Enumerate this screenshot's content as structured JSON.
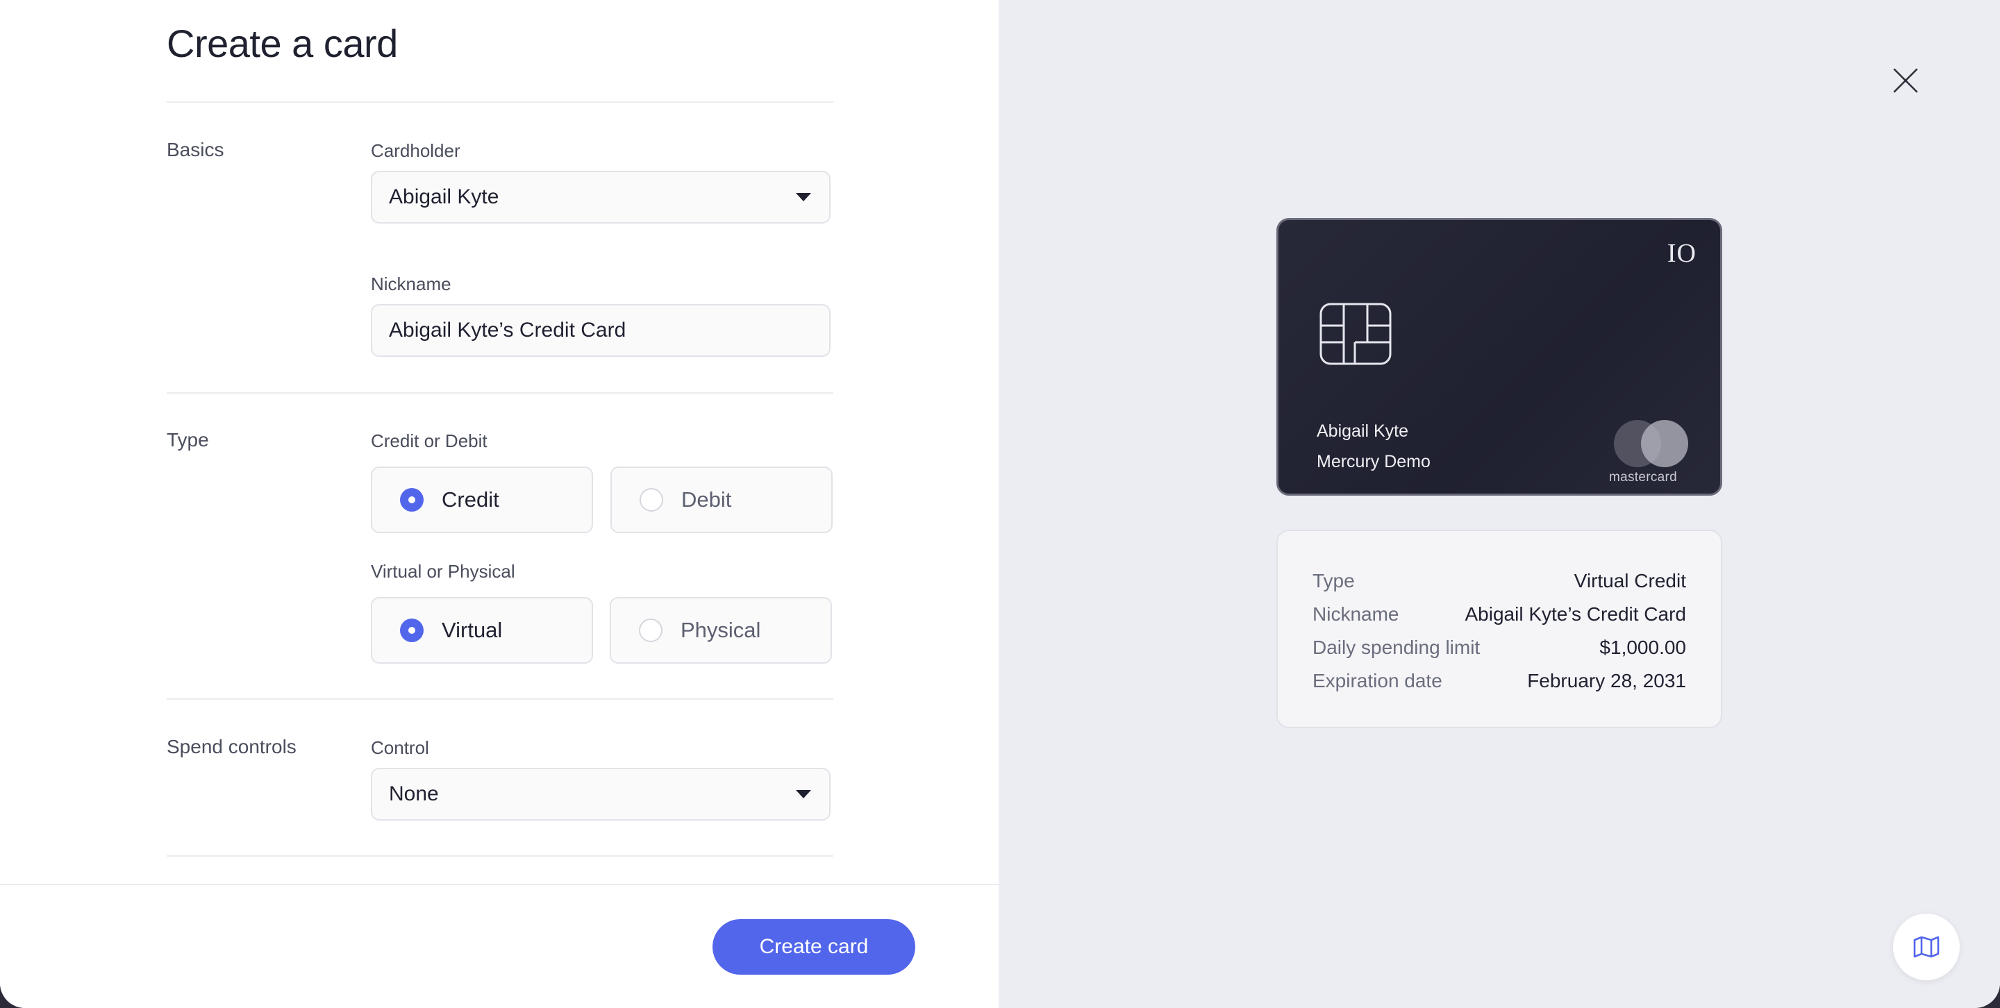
{
  "form": {
    "title": "Create a card",
    "basics": {
      "section_label": "Basics",
      "cardholder_label": "Cardholder",
      "cardholder_value": "Abigail Kyte",
      "nickname_label": "Nickname",
      "nickname_value": "Abigail Kyte’s Credit Card"
    },
    "type": {
      "section_label": "Type",
      "credit_debit_label": "Credit or Debit",
      "credit_option": "Credit",
      "debit_option": "Debit",
      "selected_credit_debit": "Credit",
      "virtual_physical_label": "Virtual or Physical",
      "virtual_option": "Virtual",
      "physical_option": "Physical",
      "selected_virtual_physical": "Virtual"
    },
    "spend_controls": {
      "section_label": "Spend controls",
      "control_label": "Control",
      "control_value": "None"
    },
    "create_button_label": "Create card"
  },
  "preview": {
    "card": {
      "logo_text": "IO",
      "holder_name": "Abigail Kyte",
      "company": "Mercury Demo",
      "network": "mastercard",
      "chip_icon": "chip-icon"
    },
    "summary": [
      {
        "key": "Type",
        "value": "Virtual Credit"
      },
      {
        "key": "Nickname",
        "value": "Abigail Kyte’s Credit Card"
      },
      {
        "key": "Daily spending limit",
        "value": "$1,000.00"
      },
      {
        "key": "Expiration date",
        "value": "February 28, 2031"
      }
    ]
  },
  "icons": {
    "close": "close-icon",
    "map": "map-icon",
    "dropdown": "caret-down-icon"
  },
  "colors": {
    "accent": "#5266eb",
    "right_panel_bg": "#ecedf3",
    "card_bg": "#1f2030"
  }
}
